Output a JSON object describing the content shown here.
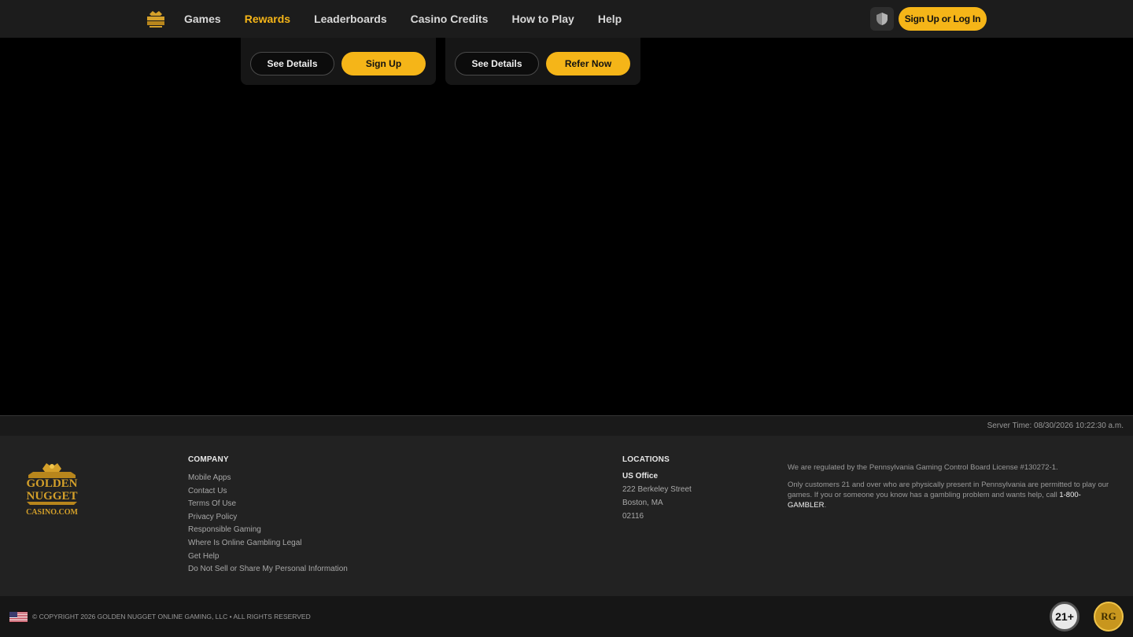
{
  "header": {
    "logo_name": "golden-nugget-logo",
    "nav": [
      {
        "label": "Games",
        "active": false
      },
      {
        "label": "Rewards",
        "active": true
      },
      {
        "label": "Leaderboards",
        "active": false
      },
      {
        "label": "Casino Credits",
        "active": false
      },
      {
        "label": "How to Play",
        "active": false
      },
      {
        "label": "Help",
        "active": false
      }
    ],
    "signup_label": "Sign Up or Log In",
    "accent_color": "#f5b518"
  },
  "cards": [
    {
      "details_label": "See Details",
      "action_label": "Sign Up"
    },
    {
      "details_label": "See Details",
      "action_label": "Refer Now"
    }
  ],
  "server": {
    "time_text": "Server Time: 08/30/2026 10:22:30 a.m."
  },
  "footer": {
    "logo_text": {
      "line1": "GOLDEN",
      "line2": "NUGGET",
      "line3": "CASINO.COM"
    },
    "company": {
      "title": "COMPANY",
      "links": [
        "Mobile Apps",
        "Contact Us",
        "Terms Of Use",
        "Privacy Policy",
        "Responsible Gaming",
        "Where Is Online Gambling Legal",
        "Get Help",
        "Do Not Sell or Share My Personal Information"
      ]
    },
    "locations": {
      "title": "LOCATIONS",
      "office_label": "US Office",
      "street": "222 Berkeley Street",
      "city": "Boston, MA",
      "zip": "02116"
    },
    "legal": {
      "regulated": "We are regulated by the Pennsylvania Gaming Control Board License #130272-1.",
      "customers": "Only customers 21 and over who are physically present in Pennsylvania are permitted to play our games. If you or someone you know has a gambling problem and wants help, call ",
      "phone": "1-800-GAMBLER",
      "period": "."
    }
  },
  "bottom": {
    "copyright": "© COPYRIGHT 2026 GOLDEN NUGGET ONLINE GAMING, LLC • ALL RIGHTS RESERVED",
    "age_badge": "21+",
    "rg_badge": "RG"
  }
}
